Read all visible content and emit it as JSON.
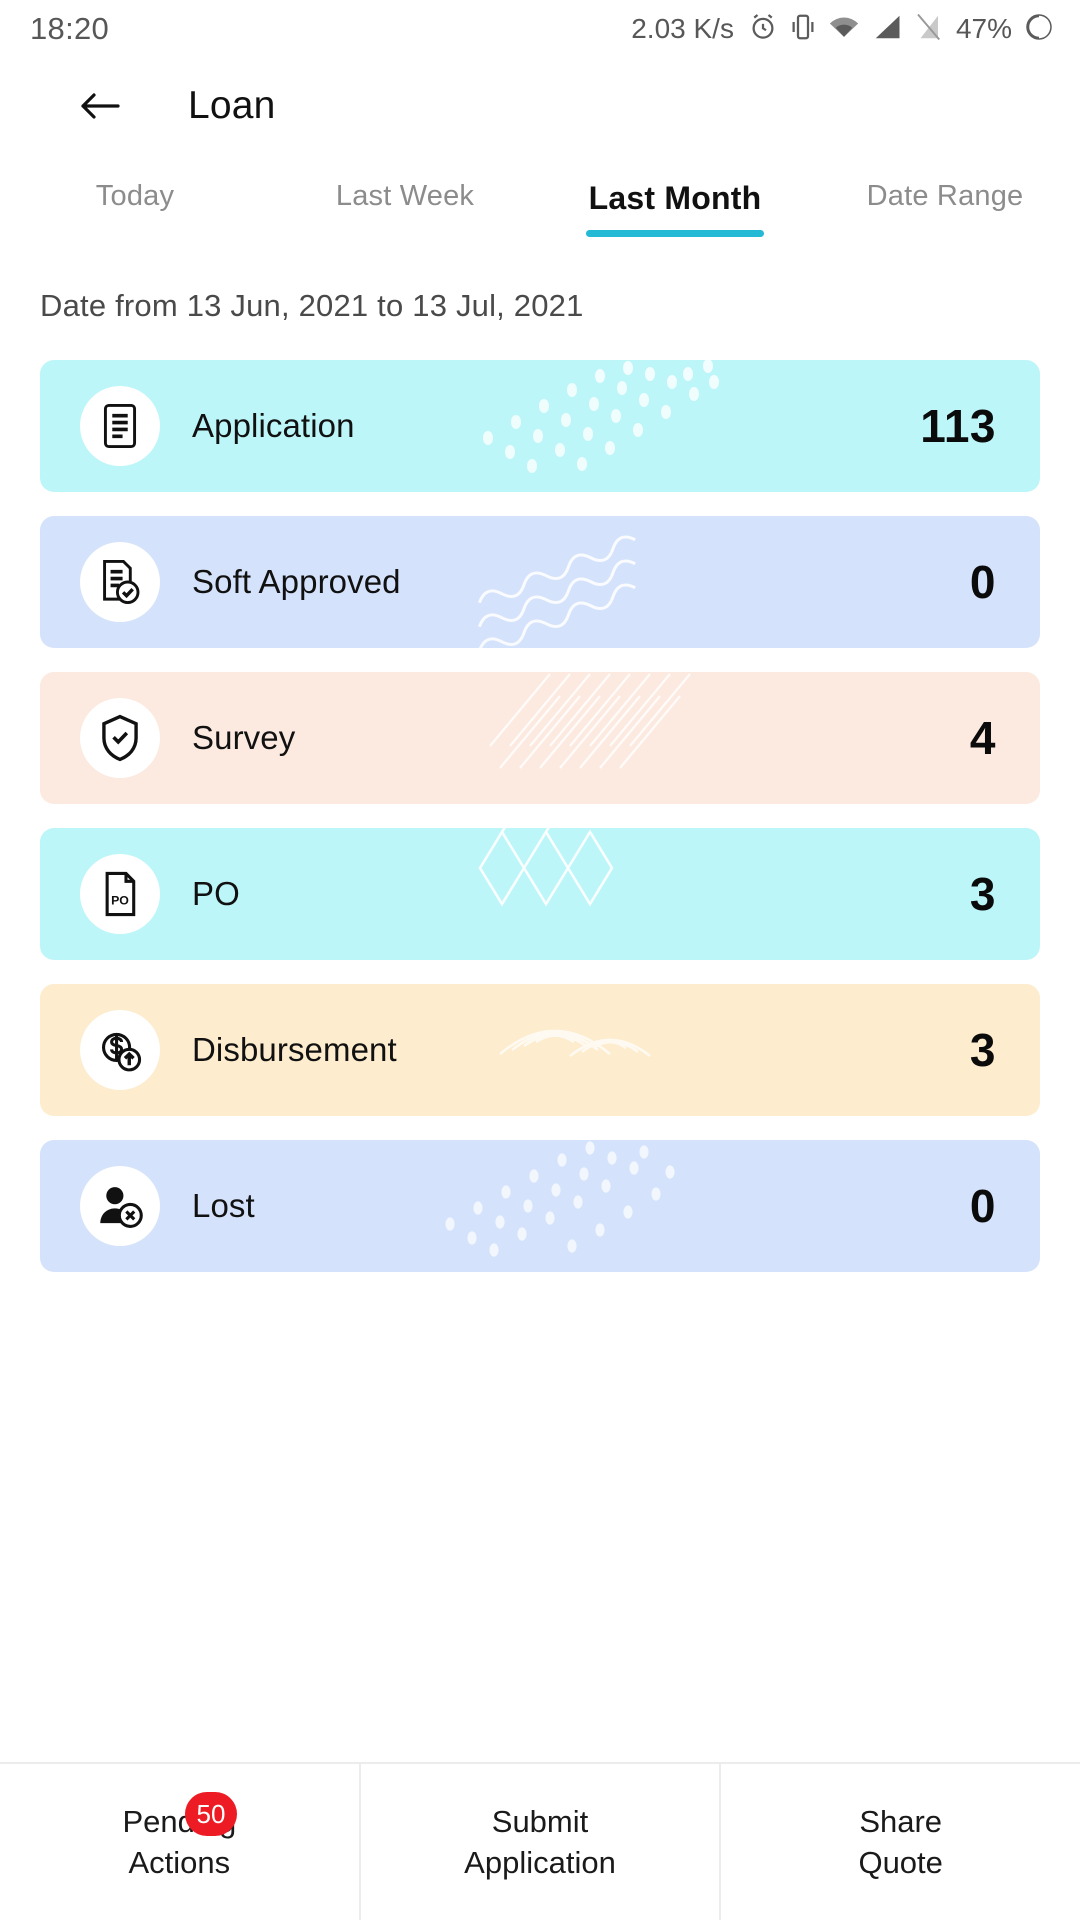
{
  "statusbar": {
    "time": "18:20",
    "network_speed": "2.03 K/s",
    "battery_percent": "47%",
    "icons": [
      "alarm-icon",
      "vibrate-icon",
      "wifi-icon",
      "signal-icon",
      "sim-icon",
      "battery-icon"
    ]
  },
  "appbar": {
    "back_icon": "arrow-left-icon",
    "title": "Loan"
  },
  "tabs": [
    {
      "label": "Today",
      "active": false
    },
    {
      "label": "Last Week",
      "active": false
    },
    {
      "label": "Last Month",
      "active": true
    },
    {
      "label": "Date Range",
      "active": false
    }
  ],
  "date_range_text": "Date from 13 Jun, 2021 to 13 Jul, 2021",
  "colors": {
    "accent": "#24b9d4",
    "badge": "#ed1b24",
    "cyan_card": "#bdf6f9",
    "blue_card": "#d4e3fb",
    "peach_card": "#fce9df",
    "cream_card": "#fdeccd"
  },
  "cards": [
    {
      "label": "Application",
      "value": "113",
      "bg": "#bdf6f9",
      "icon": "document-lines-icon",
      "deco": "dots"
    },
    {
      "label": "Soft Approved",
      "value": "0",
      "bg": "#d4e3fb",
      "icon": "document-check-icon",
      "deco": "waves"
    },
    {
      "label": "Survey",
      "value": "4",
      "bg": "#fce9df",
      "icon": "shield-check-icon",
      "deco": "hatch"
    },
    {
      "label": "PO",
      "value": "3",
      "bg": "#bdf6f9",
      "icon": "po-file-icon",
      "deco": "diamond"
    },
    {
      "label": "Disbursement",
      "value": "3",
      "bg": "#fdeccd",
      "icon": "money-up-icon",
      "deco": "arcs"
    },
    {
      "label": "Lost",
      "value": "0",
      "bg": "#d4e3fb",
      "icon": "user-x-icon",
      "deco": "dots2"
    }
  ],
  "bottombar": [
    {
      "line1": "Pending",
      "line2": "Actions",
      "badge": "50"
    },
    {
      "line1": "Submit",
      "line2": "Application",
      "badge": null
    },
    {
      "line1": "Share",
      "line2": "Quote",
      "badge": null
    }
  ]
}
